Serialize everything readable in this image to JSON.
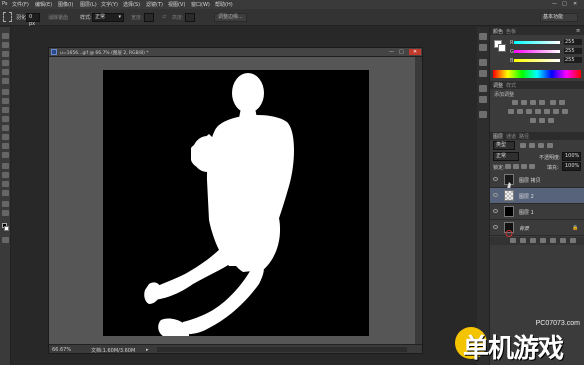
{
  "menu": [
    "文件(F)",
    "编辑(E)",
    "图像(I)",
    "图层(L)",
    "文字(Y)",
    "选择(S)",
    "滤镜(T)",
    "视图(V)",
    "窗口(W)",
    "帮助(H)"
  ],
  "options": {
    "size_label": "羽化:",
    "size_value": "0 px",
    "antialias_label": "消除锯齿",
    "style_label": "样式:",
    "style_value": "正常",
    "width_label": "宽度:",
    "height_label": "高度:",
    "refine_label": "调整边缘...",
    "workspace_value": "基本功能"
  },
  "document": {
    "title": "u=1656...gif @ 66.7% (图层 2, RGB/8) *",
    "zoom": "66.67%",
    "doc_info": "文档:1.60M/3.60M"
  },
  "color_panel": {
    "tabs": [
      "颜色",
      "色板"
    ],
    "r": "255",
    "g": "255",
    "b": "255",
    "r_label": "R",
    "g_label": "G",
    "b_label": "B"
  },
  "adjust_panel": {
    "tabs": [
      "调整",
      "样式"
    ],
    "title": "添加调整"
  },
  "layers_panel": {
    "tabs": [
      "图层",
      "通道",
      "路径"
    ],
    "kind_label": "类型",
    "blend_mode": "正常",
    "opacity_label": "不透明度:",
    "opacity_value": "100%",
    "lock_label": "锁定:",
    "fill_label": "填充:",
    "fill_value": "100%",
    "layers": [
      {
        "name": "图层 拷贝"
      },
      {
        "name": "图层 2"
      },
      {
        "name": "图层 1"
      },
      {
        "name": "背景"
      }
    ]
  },
  "watermark": {
    "url": "PC07073.com",
    "brand": "单机游戏"
  },
  "colors": {
    "accent_selected_layer": "#56637a",
    "canvas": "#000000",
    "figure": "#ffffff"
  }
}
